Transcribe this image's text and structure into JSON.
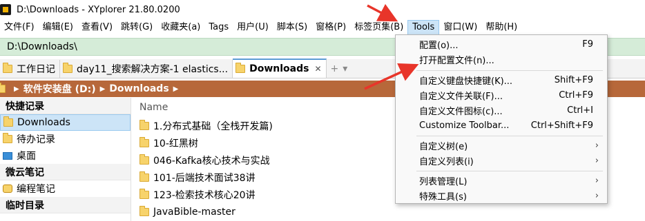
{
  "window": {
    "title": "D:\\Downloads - XYplorer 21.80.0200"
  },
  "menubar": {
    "items": [
      "文件(F)",
      "编辑(E)",
      "查看(V)",
      "跳转(G)",
      "收藏夹(a)",
      "Tags",
      "用户(U)",
      "脚本(S)",
      "窗格(P)",
      "标签页集(B)",
      "Tools",
      "窗口(W)",
      "帮助(H)"
    ],
    "active": "Tools"
  },
  "addressbar": {
    "path": "D:\\Downloads\\"
  },
  "tabs": [
    {
      "label": "工作日记",
      "active": false
    },
    {
      "label": "day11_搜索解决方案-1 elastics...",
      "active": false
    },
    {
      "label": "Downloads",
      "active": true
    }
  ],
  "breadcrumb": {
    "items": [
      "软件安装盘 (D:)",
      "Downloads"
    ]
  },
  "tree": {
    "sections": [
      {
        "header": "快捷记录",
        "items": [
          {
            "label": "Downloads",
            "selected": true
          },
          {
            "label": "待办记录"
          },
          {
            "label": "桌面"
          }
        ]
      },
      {
        "header": "微云笔记",
        "items": [
          {
            "label": "编程笔记"
          }
        ]
      },
      {
        "header": "临时目录",
        "items": []
      }
    ]
  },
  "filelist": {
    "column_name": "Name",
    "rows": [
      "1.分布式基础（全栈开发篇)",
      "10-红黑树",
      "046-Kafka核心技术与实战",
      "101-后端技术面试38讲",
      "123-检索技术核心20讲",
      "JavaBible-master"
    ]
  },
  "tools_menu": {
    "items": [
      {
        "label": "配置(o)...",
        "shortcut": "F9"
      },
      {
        "label": "打开配置文件(n)...",
        "shortcut": ""
      },
      {
        "label": "自定义键盘快捷键(K)...",
        "shortcut": "Shift+F9"
      },
      {
        "label": "自定义文件关联(F)...",
        "shortcut": "Ctrl+F9"
      },
      {
        "label": "自定义文件图标(c)...",
        "shortcut": "Ctrl+I"
      },
      {
        "label": "Customize Toolbar...",
        "shortcut": "Ctrl+Shift+F9"
      },
      {
        "label": "自定义树(e)",
        "submenu": true
      },
      {
        "label": "自定义列表(i)",
        "submenu": true
      },
      {
        "label": "列表管理(L)",
        "submenu": true
      },
      {
        "label": "特殊工具(s)",
        "submenu": true
      }
    ]
  },
  "colors": {
    "accent_red": "#e8352a",
    "address_bg": "#d5ecd8",
    "breadcrumb_bg": "#b7683a",
    "selection_bg": "#cce4f7"
  }
}
